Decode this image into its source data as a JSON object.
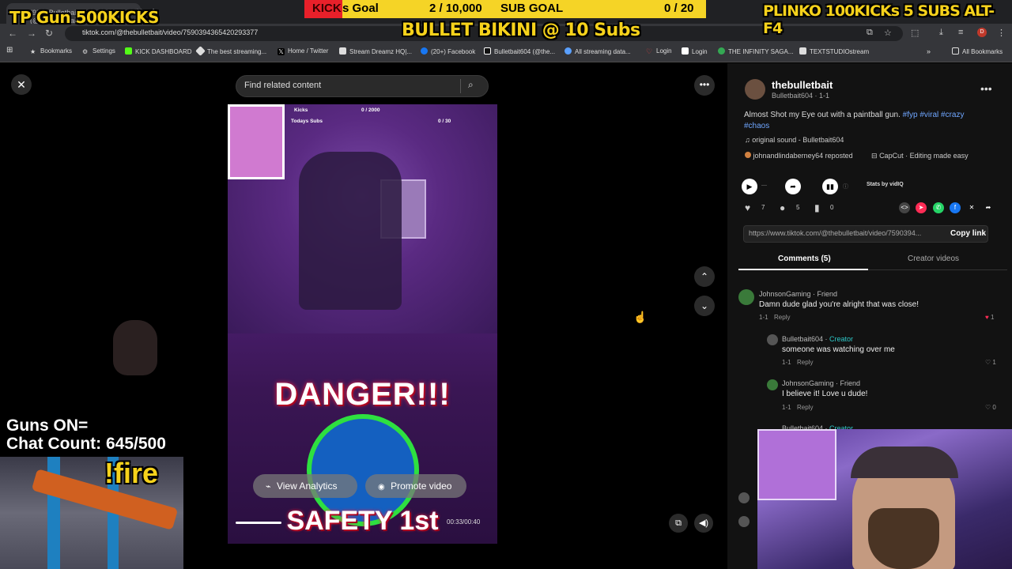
{
  "browser": {
    "tab_title": "(99+) Bulletbait604 (@thebulletbait) | TikTok",
    "url": "tiktok.com/@thebulletbait/video/7590394365420293377",
    "bookmarks": [
      "Bookmarks",
      "Settings",
      "KICK DASHBOARD",
      "The best streaming...",
      "Home / Twitter",
      "Stream Dreamz HQ|...",
      "(20+) Facebook",
      "Bulletbait604 (@the...",
      "All streaming data...",
      "Login",
      "Login",
      "THE INFINITY SAGA...",
      "TEXTSTUDIOstream"
    ],
    "all_bookmarks": "All Bookmarks"
  },
  "overlay": {
    "tp_gun": "TP Gun 500KICKS",
    "plinko": "PLINKO 100KICKs  5 SUBS ALT-F4",
    "bikini": "BULLET BIKINI @ 10 Subs",
    "kick_label": "KICK",
    "kick_goal": "s Goal",
    "kick_value": "2 / 10,000",
    "sub_goal": "SUB GOAL",
    "sub_value": "0 / 20",
    "guns_on": "Guns ON=",
    "chat_count": "Chat Count: 645/500",
    "fire": "!fire"
  },
  "video": {
    "search_placeholder": "Find related content",
    "hud_kicks": "Kicks",
    "hud_kicks_val": "0 / 2000",
    "hud_subs": "Todays Subs",
    "hud_subs_val": "0 / 30",
    "text_danger": "DANGER!!!",
    "text_safety": "SAFETY 1st",
    "view_analytics": "View Analytics",
    "promote_video": "Promote video",
    "time": "00:33/00:40",
    "progress": 0.825
  },
  "panel": {
    "author": "thebulletbait",
    "author_sub": "Bulletbait604 · 1-1",
    "desc": "Almost Shot my Eye out with a paintball gun.",
    "tags": "#fyp #viral #crazy #chaos",
    "sound": "original sound - Bulletbait604",
    "reposted": "johnandlindaberney64 reposted",
    "capcut": "CapCut · Editing made easy",
    "stats_by": "Stats by vidIQ",
    "likes": "7",
    "comments": "5",
    "saves": "0",
    "link": "https://www.tiktok.com/@thebulletbait/video/7590394...",
    "copy_link": "Copy link",
    "tab_comments": "Comments (5)",
    "tab_creator": "Creator videos"
  },
  "comments": [
    {
      "name": "JohnsonGaming",
      "role": "Friend",
      "text": "Damn dude glad you're alright that was close!",
      "date": "1-1",
      "reply": "Reply",
      "likes": "1"
    },
    {
      "name": "Bulletbait604",
      "role": "Creator",
      "text": "someone was watching over me",
      "date": "1-1",
      "reply": "Reply",
      "likes": "1"
    },
    {
      "name": "JohnsonGaming",
      "role": "Friend",
      "text": "I believe it! Love u dude!",
      "date": "1-1",
      "reply": "Reply",
      "likes": "0"
    },
    {
      "name": "Bulletbait604",
      "role": "Creator"
    }
  ]
}
